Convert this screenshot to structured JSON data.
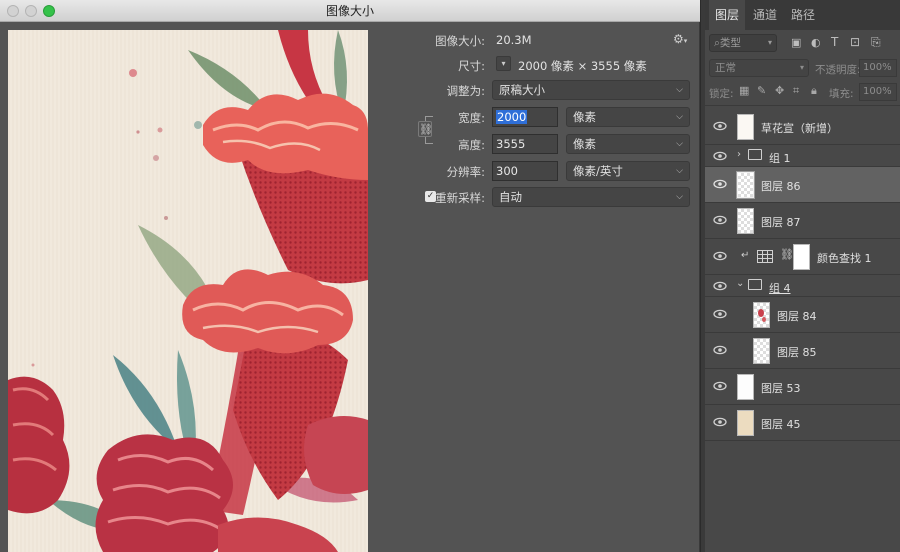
{
  "window": {
    "title": "图像大小"
  },
  "image_size": {
    "label": "图像大小:",
    "value": "20.3M"
  },
  "dimensions": {
    "label": "尺寸:",
    "value": "2000 像素  ×  3555 像素"
  },
  "fit_to": {
    "label": "调整为:",
    "value": "原稿大小"
  },
  "width": {
    "label": "宽度:",
    "value": "2000",
    "unit": "像素"
  },
  "height": {
    "label": "高度:",
    "value": "3555",
    "unit": "像素"
  },
  "resolution": {
    "label": "分辨率:",
    "value": "300",
    "unit": "像素/英寸"
  },
  "resample": {
    "label": "重新采样:",
    "value": "自动",
    "checked": true
  },
  "panel": {
    "tabs": [
      "图层",
      "通道",
      "路径"
    ],
    "filter_kind": "类型",
    "blend_mode": "正常",
    "opacity_label": "不透明度:",
    "opacity_value": "100%",
    "lock_label": "锁定:",
    "fill_label": "填充:",
    "fill_value": "100%",
    "layers": [
      {
        "name": "草花宣（新增）",
        "type": "layer"
      },
      {
        "name": "组 1",
        "type": "group",
        "collapsed": true
      },
      {
        "name": "图层 86",
        "type": "layer",
        "selected": true
      },
      {
        "name": "图层 87",
        "type": "layer"
      },
      {
        "name": "颜色查找 1",
        "type": "adjustment"
      },
      {
        "name": "组 4",
        "type": "group",
        "collapsed": false
      },
      {
        "name": "图层 84",
        "type": "layer"
      },
      {
        "name": "图层 85",
        "type": "layer"
      },
      {
        "name": "图层 53",
        "type": "layer"
      },
      {
        "name": "图层 45",
        "type": "layer"
      }
    ]
  },
  "colors": {
    "accent": "#2f6fd8",
    "selected_layer": "#626262",
    "paper": "#f1e9dd",
    "flower_red": "#c8323a"
  }
}
